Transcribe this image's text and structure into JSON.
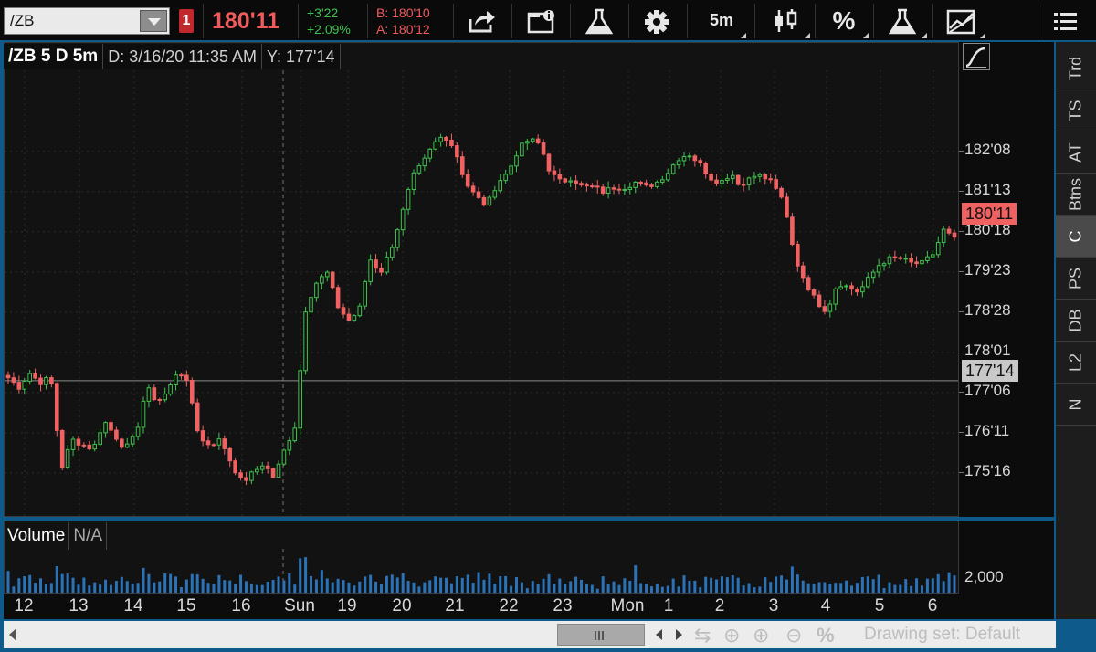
{
  "toolbar": {
    "symbol": "/ZB",
    "link_badge": "1",
    "last_price": "180'11",
    "net_change": "+3'22",
    "net_change_pct": "+2.09%",
    "bid": "B: 180'10",
    "ask": "A: 180'12",
    "timeframe": "5m",
    "percent_label": "%",
    "buttons": [
      "share-icon",
      "chart-info-icon",
      "studies-flask-icon",
      "gear-icon",
      "timeframe",
      "candle-style-icon",
      "percent",
      "strategies-flask-icon",
      "drawings-icon",
      "menu-icon"
    ]
  },
  "chart_header": {
    "symbol_desc": "/ZB 5 D 5m",
    "date": "D: 3/16/20 11:35 AM",
    "y": "Y: 177'14"
  },
  "price_axis": {
    "labels": [
      "182'08",
      "181'13",
      "180'18",
      "179'23",
      "178'28",
      "178'01",
      "177'06",
      "176'11",
      "175'16"
    ],
    "last_tag": "180'11",
    "cursor_tag": "177'14"
  },
  "volume": {
    "label": "Volume",
    "value": "N/A",
    "axis_label": "2,000"
  },
  "time_axis": {
    "labels": [
      "12",
      "13",
      "14",
      "15",
      "16",
      "Sun",
      "19",
      "20",
      "21",
      "22",
      "23",
      "Mon",
      "1",
      "2",
      "3",
      "4",
      "5",
      "6"
    ]
  },
  "bottom_bar": {
    "drawing_set": "Drawing set: Default"
  },
  "side_tabs": [
    {
      "label": "Trd",
      "active": false
    },
    {
      "label": "TS",
      "active": false
    },
    {
      "label": "AT",
      "active": false
    },
    {
      "label": "Btns",
      "active": false
    },
    {
      "label": "C",
      "active": true
    },
    {
      "label": "PS",
      "active": false
    },
    {
      "label": "DB",
      "active": false
    },
    {
      "label": "L2",
      "active": false
    },
    {
      "label": "N",
      "active": false
    }
  ],
  "colors": {
    "up": "#3fc24d",
    "down": "#f06262",
    "volume": "#2b73b8",
    "accent": "#0e5a8a"
  },
  "chart_data": {
    "type": "candlestick",
    "symbol": "/ZB",
    "interval": "5m",
    "price_ticks": [
      "175'16",
      "176'11",
      "177'06",
      "178'01",
      "178'28",
      "179'23",
      "180'18",
      "181'13",
      "182'08"
    ],
    "price_tick_values": [
      175.5,
      176.34375,
      177.1875,
      178.03125,
      178.875,
      179.71875,
      180.5625,
      181.40625,
      182.25
    ],
    "price_range": [
      174.6,
      183.95
    ],
    "last_price": 180.34375,
    "cursor_price": 177.4375,
    "session_break_after_index": 51,
    "close_path": [
      177.5,
      177.3,
      177.6,
      177.4,
      177.5,
      175.6,
      176.2,
      176.1,
      176.0,
      176.6,
      176.3,
      176.0,
      176.3,
      177.3,
      177.0,
      177.2,
      177.7,
      177.3,
      176.2,
      176.1,
      176.2,
      175.7,
      175.3,
      175.5,
      175.7,
      175.4,
      176.0,
      176.5,
      179.0,
      179.5,
      179.7,
      179.0,
      178.7,
      178.9,
      180.0,
      179.7,
      180.2,
      180.9,
      181.7,
      182.0,
      182.4,
      182.6,
      182.3,
      181.6,
      181.3,
      181.1,
      181.6,
      181.8,
      182.3,
      182.5,
      182.4,
      181.8,
      181.6,
      181.7,
      181.5,
      181.5,
      181.4,
      181.5,
      181.5,
      181.6,
      181.5,
      181.6,
      181.8,
      182.1,
      182.2,
      182.0,
      181.7,
      181.6,
      181.8,
      181.5,
      181.8,
      181.7,
      181.6,
      181.1,
      180.0,
      179.5,
      179.1,
      178.9,
      179.5,
      179.4,
      179.3,
      179.6,
      179.9,
      180.0,
      180.0,
      179.9,
      179.9,
      180.1,
      180.6,
      180.4
    ]
  }
}
